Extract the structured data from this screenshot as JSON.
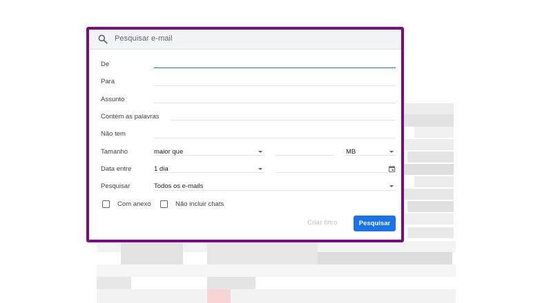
{
  "search": {
    "placeholder": "Pesquisar e-mail",
    "icon": "search-icon"
  },
  "fields": {
    "from_label": "De",
    "to_label": "Para",
    "subject_label": "Assunto",
    "has_words_label": "Contém as palavras",
    "doesnt_have_label": "Não tem",
    "size_label": "Tamanho",
    "size_operator": "maior que",
    "size_unit": "MB",
    "date_within_label": "Data entre",
    "date_within_value": "1 dia",
    "search_in_label": "Pesquisar",
    "search_in_value": "Todos os e-mails"
  },
  "checkboxes": {
    "has_attachment": "Com anexo",
    "exclude_chats": "Não incluir chats"
  },
  "actions": {
    "create_filter": "Criar filtro",
    "search": "Pesquisar"
  },
  "colors": {
    "highlight_border": "#7b0a83",
    "primary_button": "#1a73e8"
  }
}
